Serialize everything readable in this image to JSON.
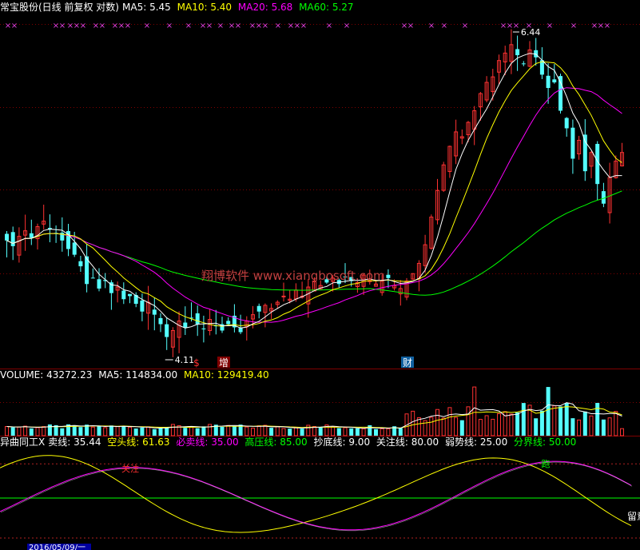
{
  "main_header": {
    "title": "常宝股份(日线 前复权 对数)",
    "ma5_label": "MA5:",
    "ma5_value": "5.45",
    "ma10_label": "MA10:",
    "ma10_value": "5.40",
    "ma20_label": "MA20:",
    "ma20_value": "5.68",
    "ma60_label": "MA60:",
    "ma60_value": "5.27"
  },
  "price_labels": {
    "high": "6.44",
    "low": "4.11"
  },
  "watermark": "翔博软件 www.xiangbosoft.com",
  "event_markers": [
    {
      "text": "$",
      "color": "#ff3030"
    },
    {
      "text": "增",
      "color": "#ffffff"
    },
    {
      "text": "财",
      "color": "#ffffff"
    }
  ],
  "volume_header": {
    "volume_label": "VOLUME:",
    "volume_value": "43272.23",
    "ma5_label": "MA5:",
    "ma5_value": "114834.00",
    "ma10_label": "MA10:",
    "ma10_value": "129419.40"
  },
  "indicator_header": {
    "name": "异曲同工X",
    "sell_label": "卖线:",
    "sell_value": "35.44",
    "short_label": "空头线:",
    "short_value": "61.63",
    "must_sell_label": "必卖线:",
    "must_sell_value": "35.00",
    "high_press_label": "高压线:",
    "high_press_value": "85.00",
    "bottom_label": "抄底线:",
    "bottom_value": "9.00",
    "watch_label": "关注线:",
    "watch_value": "80.00",
    "weak_label": "弱势线:",
    "weak_value": "25.00",
    "divide_label": "分界线:",
    "divide_value": "50.00"
  },
  "indicator_markers": {
    "watch": "关注",
    "run": "跑",
    "stay": "留意"
  },
  "date_label": "2016/05/09/一",
  "colors": {
    "up": "#ff3232",
    "down": "#54ffff",
    "ma5": "#ffffff",
    "ma10": "#ffff00",
    "ma20": "#ff00ff",
    "ma60": "#00ff00",
    "grid": "#800000",
    "dotted": "#b02020"
  },
  "chart_data": [
    {
      "type": "candlestick",
      "title": "常宝股份(日线 前复权 对数)",
      "y_scale": "log",
      "highest_label": 6.44,
      "lowest_label": 4.11,
      "series": [
        {
          "name": "MA5",
          "last": 5.45
        },
        {
          "name": "MA10",
          "last": 5.4
        },
        {
          "name": "MA20",
          "last": 5.68
        },
        {
          "name": "MA60",
          "last": 5.27
        }
      ],
      "closes": [
        4.78,
        4.74,
        4.81,
        4.85,
        4.8,
        4.88,
        4.92,
        4.86,
        4.83,
        4.78,
        4.72,
        4.68,
        4.6,
        4.48,
        4.52,
        4.45,
        4.5,
        4.42,
        4.46,
        4.38,
        4.4,
        4.35,
        4.3,
        4.36,
        4.28,
        4.22,
        4.14,
        4.18,
        4.24,
        4.2,
        4.26,
        4.22,
        4.19,
        4.25,
        4.21,
        4.18,
        4.22,
        4.2,
        4.17,
        4.24,
        4.28,
        4.3,
        4.34,
        4.32,
        4.36,
        4.4,
        4.38,
        4.44,
        4.4,
        4.46,
        4.5,
        4.47,
        4.49,
        4.52,
        4.48,
        4.53,
        4.5,
        4.49,
        4.54,
        4.51,
        4.48,
        4.5,
        4.52,
        4.47,
        4.45,
        4.5,
        4.55,
        4.62,
        4.75,
        4.95,
        5.15,
        5.35,
        5.5,
        5.62,
        5.58,
        5.7,
        5.8,
        5.95,
        6.05,
        6.1,
        6.25,
        6.32,
        6.4,
        6.3,
        6.22,
        6.35,
        6.28,
        6.12,
        6.0,
        6.05,
        5.8,
        5.65,
        5.4,
        5.55,
        5.3,
        5.45,
        5.2,
        5.05,
        5.25,
        5.38,
        5.45
      ]
    },
    {
      "type": "bar",
      "title": "VOLUME",
      "series": [
        {
          "name": "VOLUME",
          "last": 43272.23
        },
        {
          "name": "MA5",
          "last": 114834.0
        },
        {
          "name": "MA10",
          "last": 129419.4
        }
      ]
    },
    {
      "type": "line",
      "title": "异曲同工X",
      "ylim": [
        0,
        100
      ],
      "series": [
        {
          "name": "卖线",
          "last": 35.44
        },
        {
          "name": "空头线",
          "last": 61.63
        }
      ],
      "reference_lines": [
        {
          "name": "必卖线",
          "value": 35.0
        },
        {
          "name": "高压线",
          "value": 85.0
        },
        {
          "name": "抄底线",
          "value": 9.0
        },
        {
          "name": "关注线",
          "value": 80.0
        },
        {
          "name": "弱势线",
          "value": 25.0
        },
        {
          "name": "分界线",
          "value": 50.0
        }
      ]
    }
  ]
}
